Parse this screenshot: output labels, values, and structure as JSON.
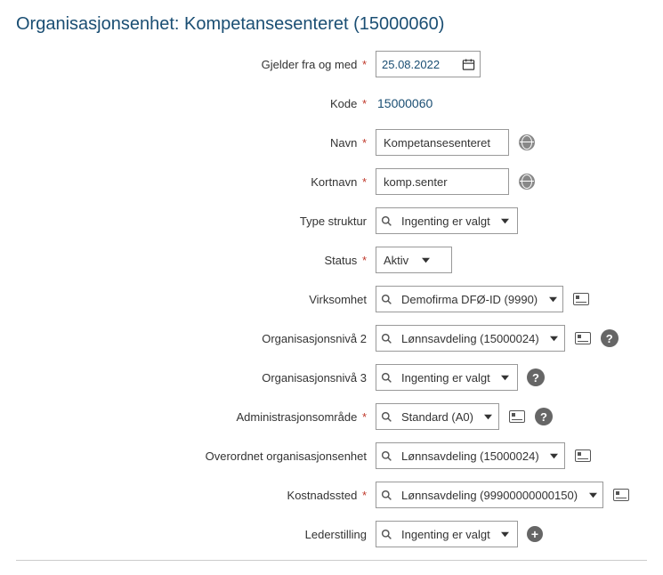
{
  "title": "Organisasjonsenhet: Kompetansesenteret (15000060)",
  "fields": {
    "gjelder": {
      "label": "Gjelder fra og med",
      "required": true,
      "value": "25.08.2022"
    },
    "kode": {
      "label": "Kode",
      "required": true,
      "value": "15000060"
    },
    "navn": {
      "label": "Navn",
      "required": true,
      "value": "Kompetansesenteret"
    },
    "kortnavn": {
      "label": "Kortnavn",
      "required": true,
      "value": "komp.senter"
    },
    "typestruktur": {
      "label": "Type struktur",
      "required": false,
      "value": "Ingenting er valgt"
    },
    "status": {
      "label": "Status",
      "required": true,
      "value": "Aktiv"
    },
    "virksomhet": {
      "label": "Virksomhet",
      "required": false,
      "value": "Demofirma DFØ-ID (9990)"
    },
    "orgniv2": {
      "label": "Organisasjonsnivå 2",
      "required": false,
      "value": "Lønnsavdeling (15000024)"
    },
    "orgniv3": {
      "label": "Organisasjonsnivå 3",
      "required": false,
      "value": "Ingenting er valgt"
    },
    "admomr": {
      "label": "Administrasjonsområde",
      "required": true,
      "value": "Standard (A0)"
    },
    "overordnet": {
      "label": "Overordnet organisasjonsenhet",
      "required": false,
      "value": "Lønnsavdeling (15000024)"
    },
    "kostnadssted": {
      "label": "Kostnadssted",
      "required": true,
      "value": "Lønnsavdeling (99900000000150)"
    },
    "lederstilling": {
      "label": "Lederstilling",
      "required": false,
      "value": "Ingenting er valgt"
    }
  },
  "glyphs": {
    "required": "*",
    "help": "?",
    "plus": "+"
  }
}
